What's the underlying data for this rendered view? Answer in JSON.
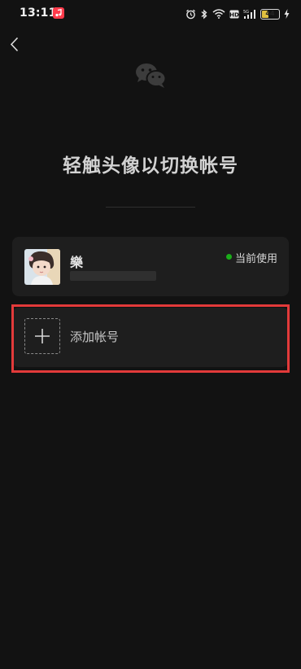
{
  "status_bar": {
    "time": "13:11",
    "battery_level": "44",
    "battery_fraction": 0.44,
    "icons": [
      "music-app-icon",
      "alarm-icon",
      "bluetooth-icon",
      "wifi-icon",
      "hd-icon",
      "signal-icon",
      "battery-icon",
      "charging-icon"
    ]
  },
  "header": {
    "back_icon": "back-chevron-icon",
    "logo_icon": "wechat-logo-icon",
    "title": "轻触头像以切换帐号"
  },
  "accounts": [
    {
      "name": "樂",
      "status": "当前使用",
      "status_color": "#1aad19",
      "avatar_icon": "child-photo-avatar"
    }
  ],
  "add_account": {
    "label": "添加帐号",
    "icon": "plus-icon"
  },
  "colors": {
    "background": "#121212",
    "card": "#1e1e1e",
    "highlight": "#e23a3a"
  }
}
